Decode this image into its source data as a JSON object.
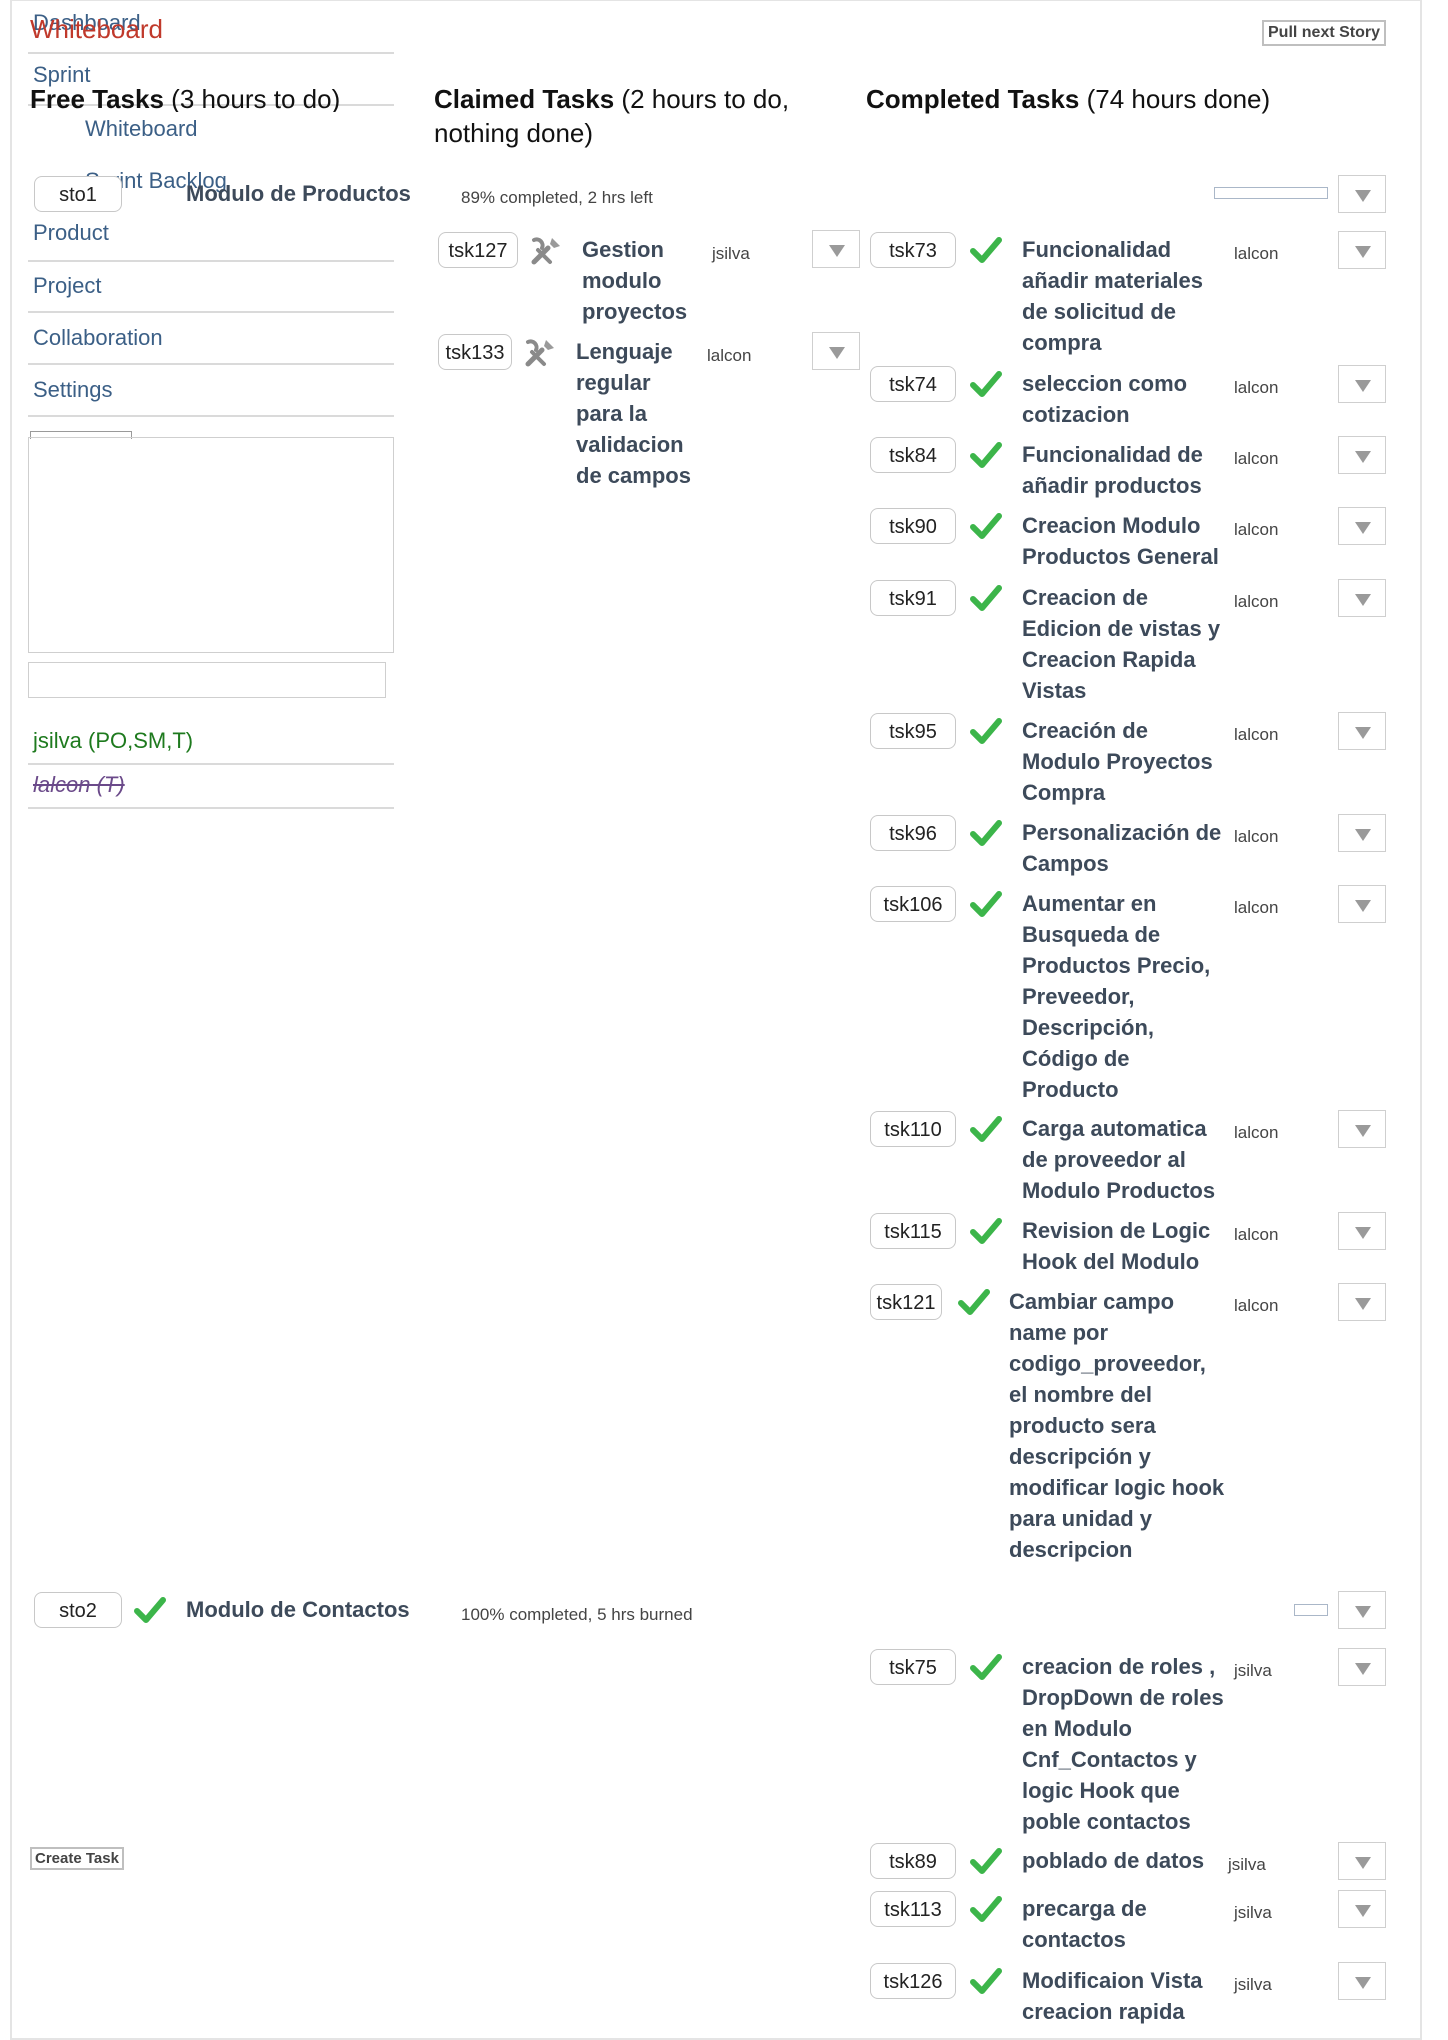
{
  "nav": {
    "dashboard": "Dashboard",
    "whiteboard_title": "Whiteboard",
    "sprint": "Sprint",
    "sprint_sub": [
      "Whiteboard",
      "Sprint Backlog"
    ],
    "items": [
      "Product",
      "Project",
      "Collaboration",
      "Settings"
    ]
  },
  "members": [
    {
      "label": "jsilva (PO,SM,T)",
      "color": "#1e7a1e"
    },
    {
      "label": "lalcon (T)",
      "color": "#6b4a8a"
    }
  ],
  "toolbar": {
    "pull_next": "Pull next Story",
    "create_task": "Create Task"
  },
  "columns": {
    "free": {
      "label": "Free Tasks",
      "detail": "(3 hours to do)"
    },
    "claimed": {
      "label": "Claimed Tasks",
      "detail": "(2 hours to do, nothing done)"
    },
    "completed": {
      "label": "Completed Tasks",
      "detail": "(74 hours done)"
    }
  },
  "stories": [
    {
      "id": "sto1",
      "title": "Modulo de Productos",
      "status": "89% completed, 2 hrs left",
      "progress_pct": 89,
      "claimed": [
        {
          "id": "tsk127",
          "title": "Gestion modulo proyectos",
          "owner": "jsilva"
        },
        {
          "id": "tsk133",
          "title": "Lenguaje regular para la validacion de campos",
          "owner": "lalcon"
        }
      ],
      "completed": [
        {
          "id": "tsk73",
          "title": "Funcionalidad añadir materiales de solicitud de compra",
          "owner": "lalcon"
        },
        {
          "id": "tsk74",
          "title": "seleccion como cotizacion",
          "owner": "lalcon"
        },
        {
          "id": "tsk84",
          "title": "Funcionalidad de añadir productos",
          "owner": "lalcon"
        },
        {
          "id": "tsk90",
          "title": "Creacion Modulo Productos General",
          "owner": "lalcon"
        },
        {
          "id": "tsk91",
          "title": "Creacion de Edicion de vistas y Creacion Rapida Vistas",
          "owner": "lalcon"
        },
        {
          "id": "tsk95",
          "title": "Creación de Modulo Proyectos Compra",
          "owner": "lalcon"
        },
        {
          "id": "tsk96",
          "title": "Personalización de Campos",
          "owner": "lalcon"
        },
        {
          "id": "tsk106",
          "title": "Aumentar en Busqueda de Productos Precio, Preveedor, Descripción, Código de Producto",
          "owner": "lalcon"
        },
        {
          "id": "tsk110",
          "title": "Carga automatica de proveedor al Modulo Productos",
          "owner": "lalcon"
        },
        {
          "id": "tsk115",
          "title": "Revision de Logic Hook del Modulo",
          "owner": "lalcon"
        },
        {
          "id": "tsk121",
          "title": "Cambiar campo name por codigo_proveedor, el nombre del producto sera descripción y modificar logic hook para unidad y descripcion",
          "owner": "lalcon"
        }
      ]
    },
    {
      "id": "sto2",
      "title": "Modulo de Contactos",
      "status": "100% completed, 5 hrs burned",
      "progress_pct": 100,
      "completed": [
        {
          "id": "tsk75",
          "title": "creacion de roles , DropDown de roles en Modulo Cnf_Contactos y logic Hook que poble contactos",
          "owner": "jsilva"
        },
        {
          "id": "tsk89",
          "title": "poblado de datos",
          "owner": "jsilva"
        },
        {
          "id": "tsk113",
          "title": "precarga de contactos",
          "owner": "jsilva"
        },
        {
          "id": "tsk126",
          "title": "Modificaion Vista creacion rapida",
          "owner": "jsilva"
        }
      ]
    }
  ],
  "icons": {
    "done": "check-icon",
    "in_progress": "tools-icon",
    "menu": "dropdown-arrow-icon"
  },
  "colors": {
    "nav": "#3b5f86",
    "whiteboard_title": "#c0392b",
    "check": "#3cb54a"
  }
}
